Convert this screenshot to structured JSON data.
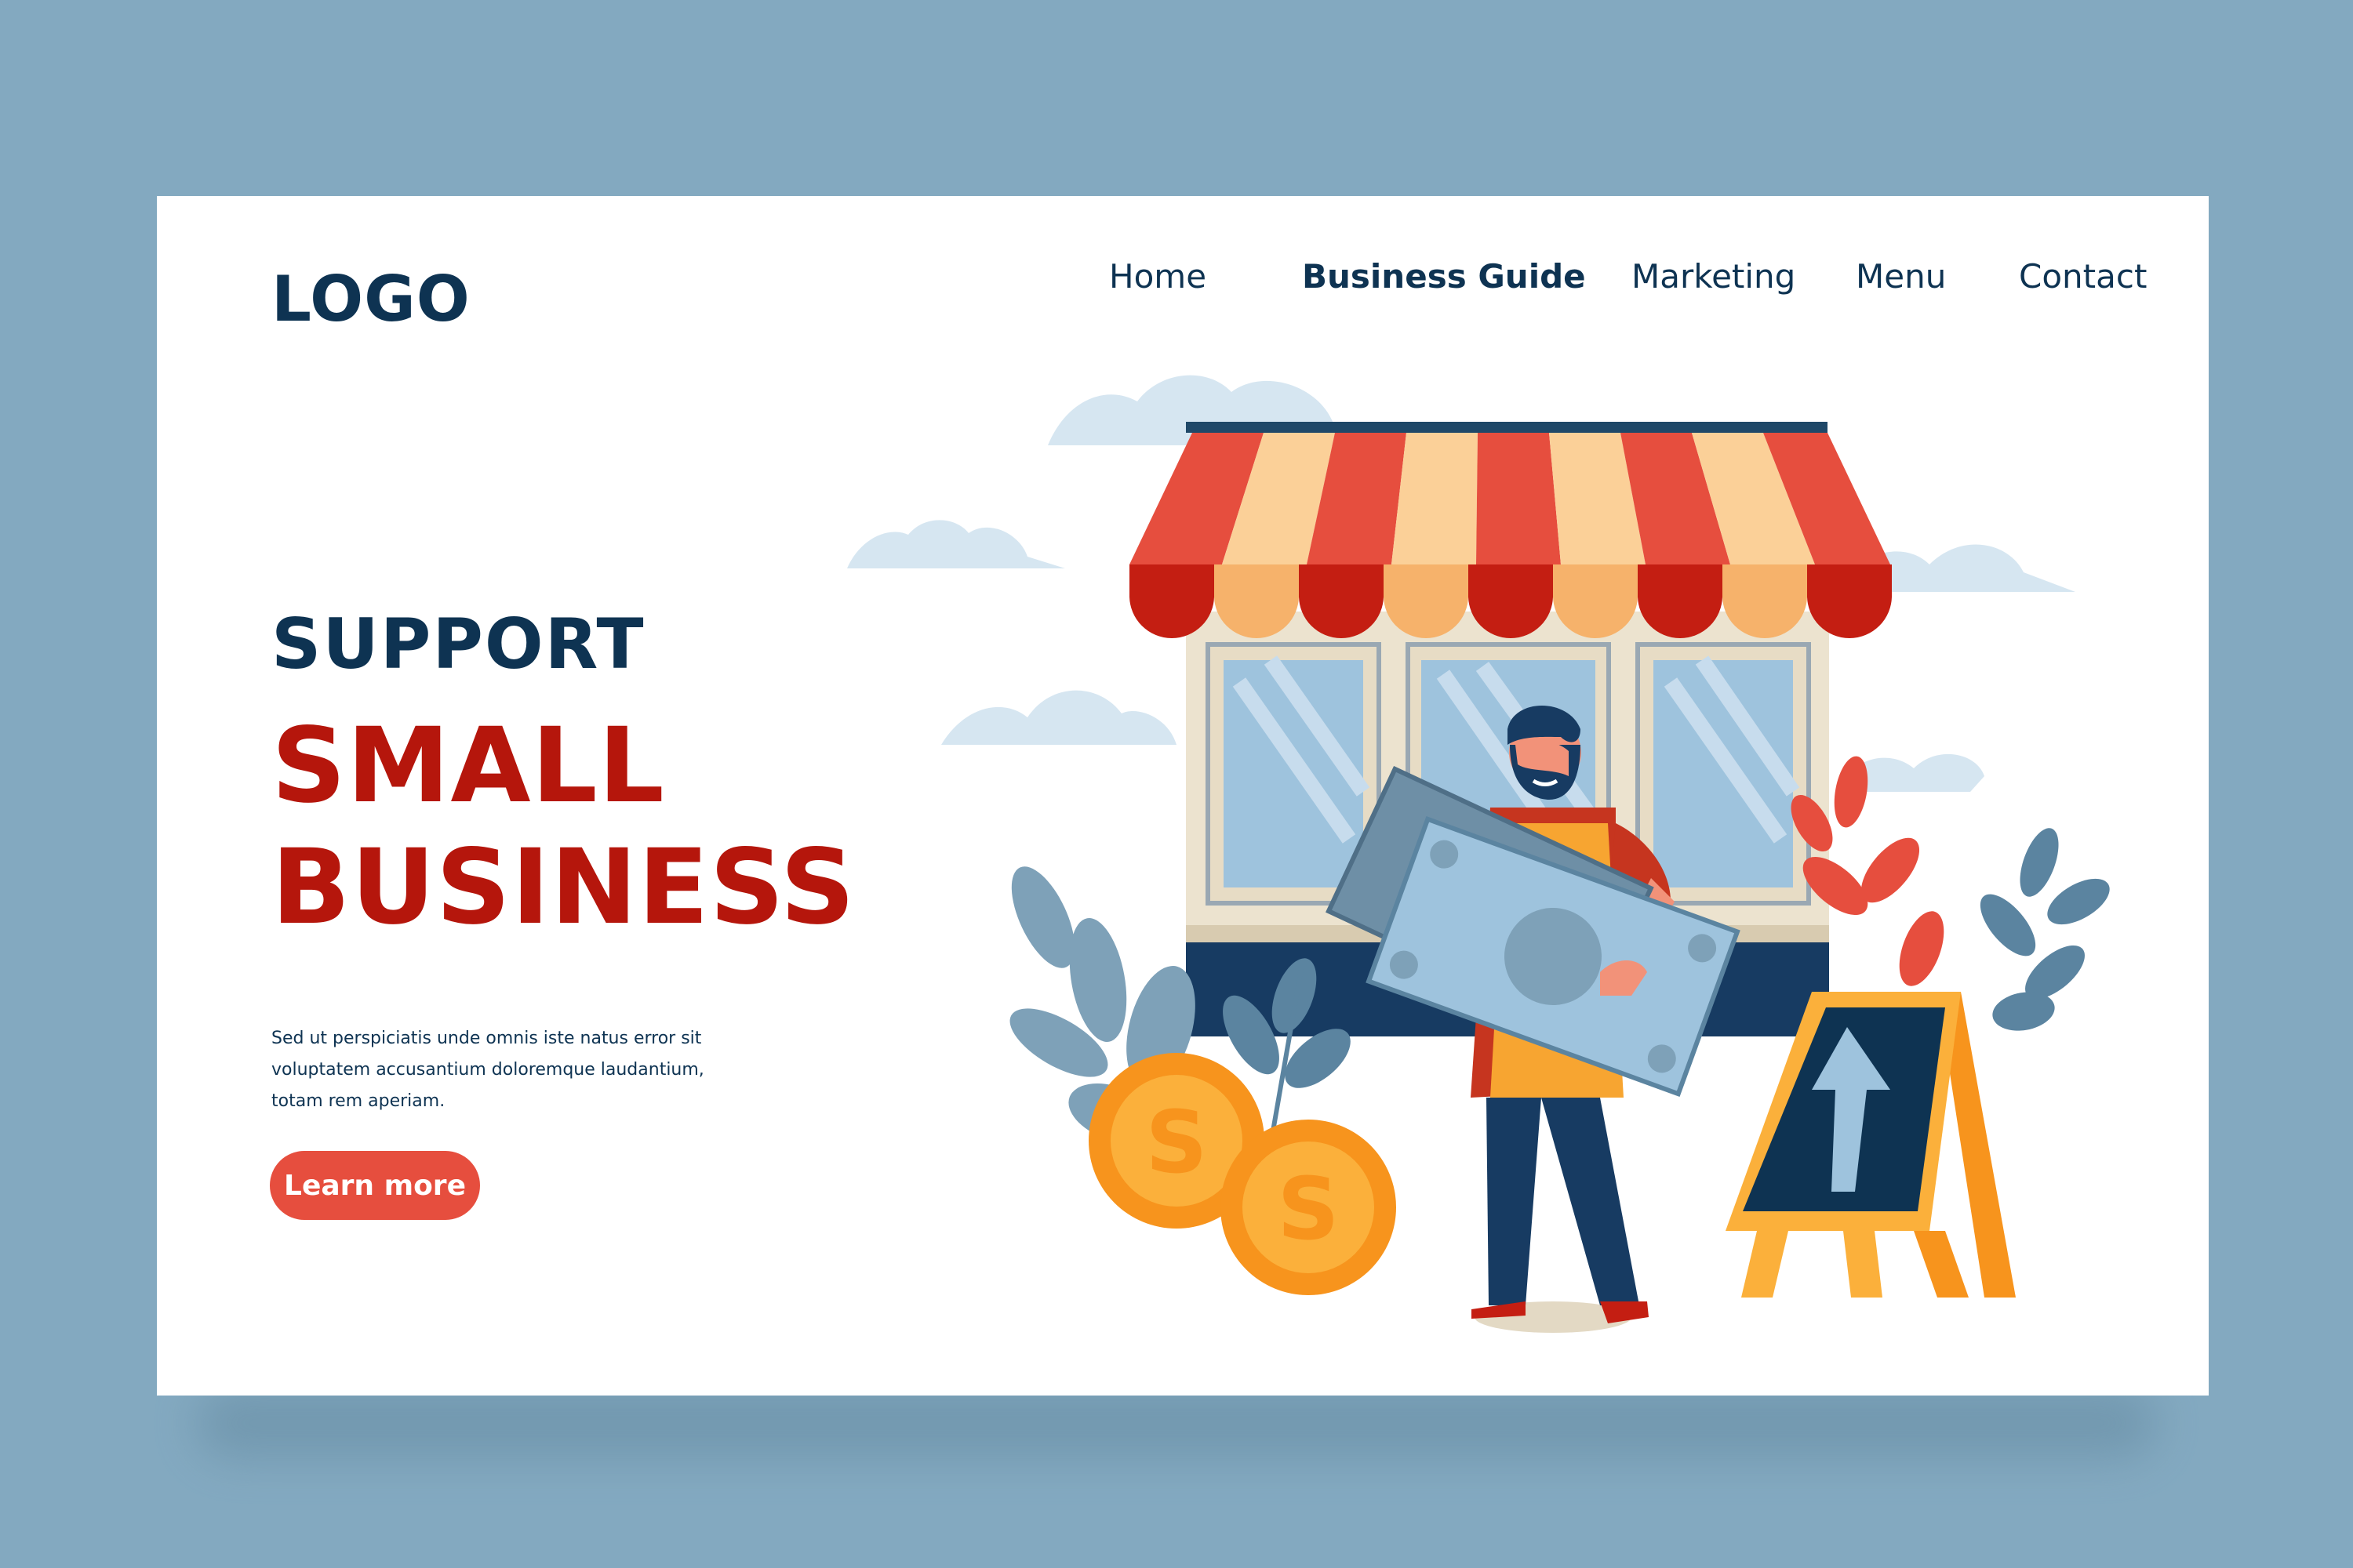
{
  "logo": "LOGO",
  "nav": {
    "items": [
      "Home",
      "Business Guide",
      "Marketing",
      "Menu",
      "Contact"
    ],
    "active": "Business Guide"
  },
  "hero": {
    "line1": "SUPPORT",
    "line2": "SMALL",
    "line3": "BUSINESS",
    "body_lines": [
      "Sed ut perspiciatis unde omnis iste natus error sit",
      "voluptatem accusantium doloremque laudantium,",
      "totam rem aperiam."
    ],
    "cta_label": "Learn more"
  },
  "coins": {
    "symbol": "S"
  },
  "colors": {
    "page_bg": "#83a9c0",
    "card_bg": "#ffffff",
    "navy": "#0e3352",
    "red": "#b5160c",
    "button": "#e64e3e",
    "orange": "#f7941d",
    "light_blue": "#9ec3dd"
  },
  "icons": [
    "shop-illustration",
    "shopkeeper-figure",
    "banknote-icon",
    "dollar-coin-icon",
    "up-arrow-sign-icon",
    "plant-icon",
    "cloud-icon"
  ]
}
